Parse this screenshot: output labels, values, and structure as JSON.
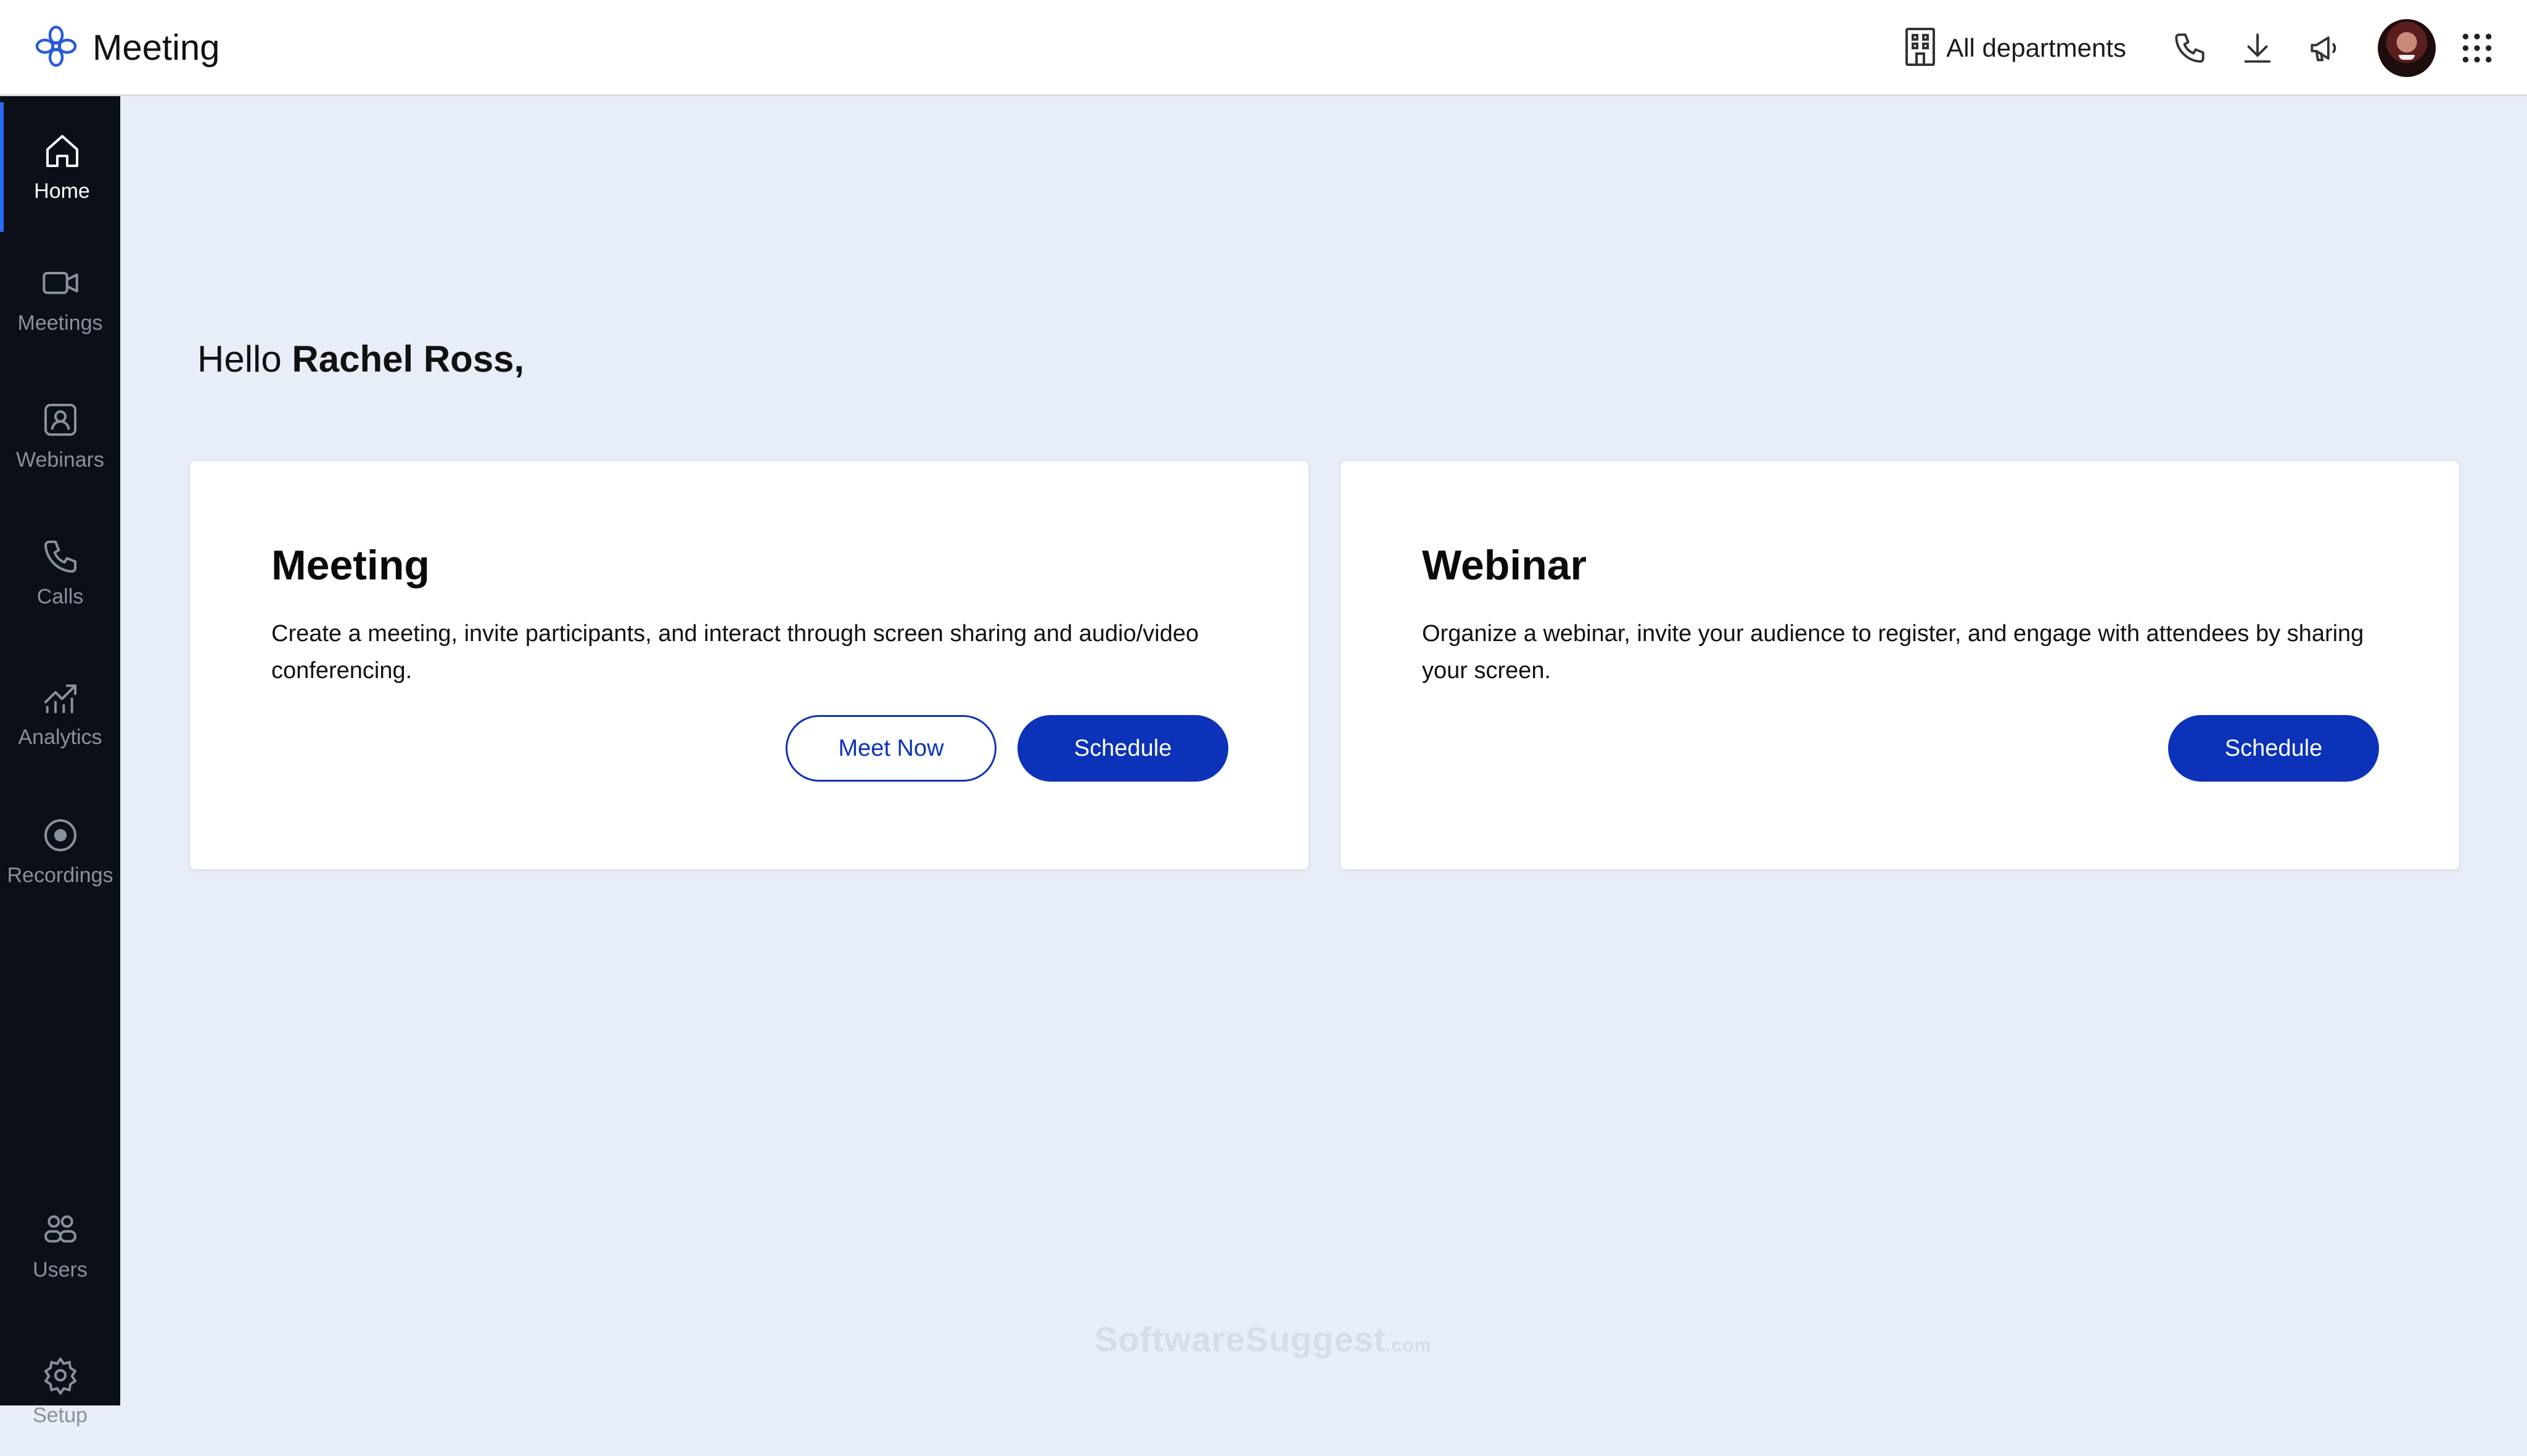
{
  "app": {
    "title": "Meeting",
    "logo_icon": "brand-flower-icon",
    "accent_color": "#0b32b8",
    "sidebar_bg": "#0b0f18",
    "page_bg": "#e8eef7"
  },
  "topbar": {
    "department_label": "All departments",
    "icons": [
      "building-icon",
      "phone-icon",
      "download-icon",
      "megaphone-icon",
      "user-avatar",
      "apps-grid-icon"
    ]
  },
  "sidebar": {
    "items": [
      {
        "label": "Home",
        "icon": "home-icon",
        "active": true
      },
      {
        "label": "Meetings",
        "icon": "video-camera-icon",
        "active": false
      },
      {
        "label": "Webinars",
        "icon": "webinar-icon",
        "active": false
      },
      {
        "label": "Calls",
        "icon": "phone-icon",
        "active": false
      },
      {
        "label": "Analytics",
        "icon": "analytics-icon",
        "active": false
      },
      {
        "label": "Recordings",
        "icon": "record-icon",
        "active": false
      }
    ],
    "bottom_items": [
      {
        "label": "Users",
        "icon": "users-icon"
      },
      {
        "label": "Setup",
        "icon": "gear-icon"
      }
    ]
  },
  "main": {
    "greeting_prefix": "Hello",
    "user_name": "Rachel Ross,",
    "cards": [
      {
        "title": "Meeting",
        "description": "Create a meeting, invite participants, and interact through screen sharing and audio/video conferencing.",
        "secondary_button": "Meet Now",
        "primary_button": "Schedule"
      },
      {
        "title": "Webinar",
        "description": "Organize a webinar, invite your audience to register, and engage with attendees by sharing your screen.",
        "primary_button": "Schedule"
      }
    ]
  },
  "watermark": {
    "text": "SoftwareSuggest",
    "suffix": ".com"
  }
}
